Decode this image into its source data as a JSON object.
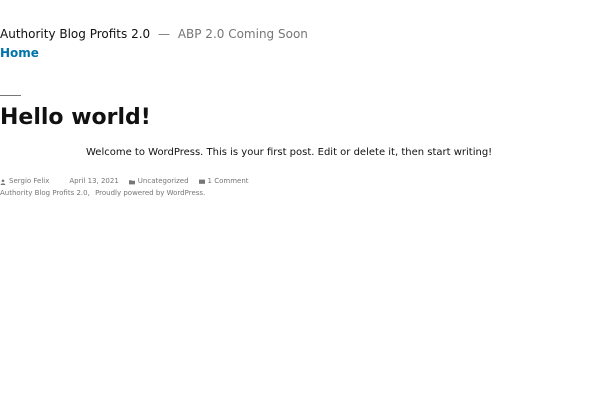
{
  "header": {
    "site_title": "Authority Blog Profits 2.0",
    "separator": "—",
    "tagline": "ABP 2.0 Coming Soon",
    "nav": {
      "home_label": "Home"
    }
  },
  "post": {
    "title": "Hello world!",
    "content": "Welcome to WordPress. This is your first post. Edit or delete it, then start writing!",
    "meta": {
      "author": "Sergio Felix",
      "author_icon": "person-icon",
      "date": "April 13, 2021",
      "date_icon": "clock-icon",
      "category": "Uncategorized",
      "category_icon": "folder-icon",
      "comments": "1 Comment",
      "comments_icon": "comment-icon"
    }
  },
  "footer": {
    "site_name": "Authority Blog Profits 2.0",
    "separator": ",",
    "powered_by": "Proudly powered by WordPress."
  },
  "colors": {
    "link": "#0073aa",
    "text": "#111111",
    "muted": "#767676"
  }
}
